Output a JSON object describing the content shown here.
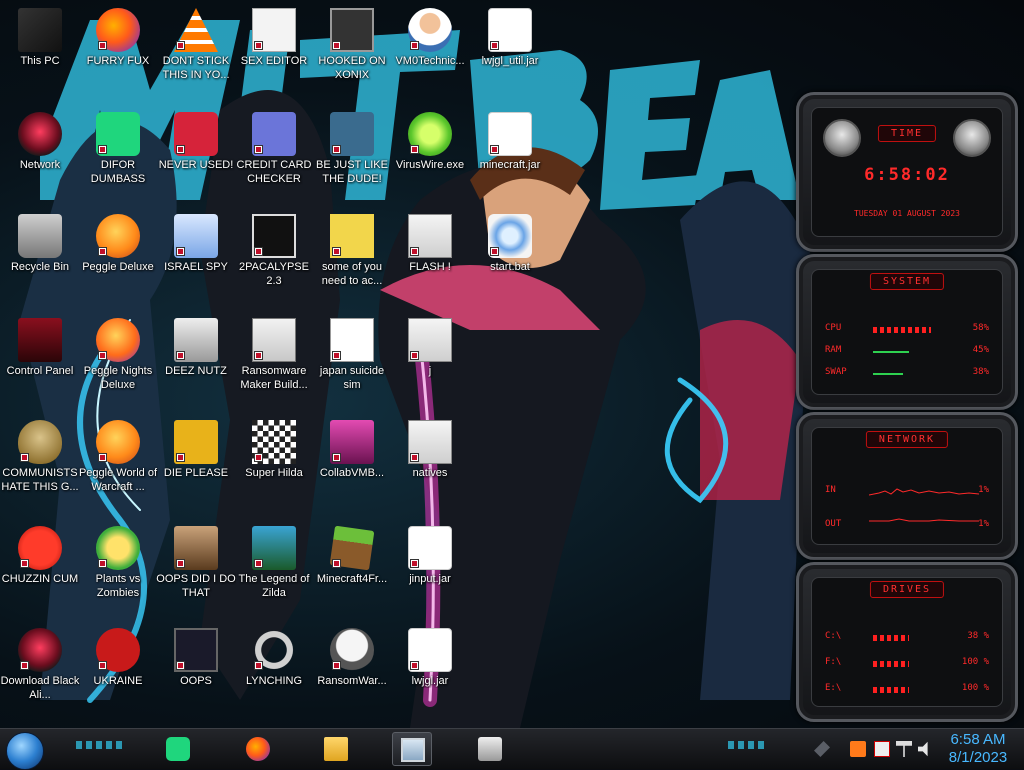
{
  "wallpaper": {
    "description": "",
    "accent": "#2fb6d6",
    "highlight": "#ff3a9a"
  },
  "desktop": {
    "icons": [
      {
        "label": "This PC",
        "icon": "computer-icon"
      },
      {
        "label": "FURRY FUX",
        "icon": "firefox-icon"
      },
      {
        "label": "DONT STICK THIS IN YO...",
        "icon": "vlc-cone-icon"
      },
      {
        "label": "SEX EDITOR",
        "icon": "xd-editor-icon"
      },
      {
        "label": "HOOKED ON XONIX",
        "icon": "xonix-icon"
      },
      {
        "label": "VM0Technic...",
        "icon": "doctor-icon"
      },
      {
        "label": "lwjgl_util.jar",
        "icon": "java-jar-icon"
      },
      {
        "label": "Network",
        "icon": "alien-network-icon"
      },
      {
        "label": "DIFOR DUMBASS",
        "icon": "green-chat-icon"
      },
      {
        "label": "NEVER USED!",
        "icon": "dev-cpp-icon"
      },
      {
        "label": "CREDIT CARD CHECKER",
        "icon": "credit-card-icon"
      },
      {
        "label": "BE JUST LIKE THE DUDE!",
        "icon": "santa-icon"
      },
      {
        "label": "VirusWire.exe",
        "icon": "lime-icon"
      },
      {
        "label": "minecraft.jar",
        "icon": "java-jar-icon"
      },
      {
        "label": "Recycle Bin",
        "icon": "recycle-bin-icon"
      },
      {
        "label": "Peggle Deluxe",
        "icon": "peggle-icon"
      },
      {
        "label": "ISRAEL SPY",
        "icon": "spy-icon"
      },
      {
        "label": "2PACALYPSE 2.3",
        "icon": "terminal-icon"
      },
      {
        "label": "some of you need to ac...",
        "icon": "beaver-icon"
      },
      {
        "label": "FLASH !",
        "icon": "folder-icon"
      },
      {
        "label": "start.bat",
        "icon": "gear-batch-icon"
      },
      {
        "label": "Control Panel",
        "icon": "control-panel-icon"
      },
      {
        "label": "Peggle Nights Deluxe",
        "icon": "peggle-nights-icon"
      },
      {
        "label": "DEEZ NUTZ",
        "icon": "stacked-windows-icon"
      },
      {
        "label": "Ransomware Maker Build...",
        "icon": "app-window-icon"
      },
      {
        "label": "japan suicide sim",
        "icon": "japan-doc-icon"
      },
      {
        "label": "j",
        "icon": "folder-icon"
      },
      {
        "label": "COMMUNISTS HATE THIS G...",
        "icon": "money-bag-icon"
      },
      {
        "label": "Peggle World of Warcraft ...",
        "icon": "peggle-wow-icon"
      },
      {
        "label": "DIE PLEASE",
        "icon": "de-icon"
      },
      {
        "label": "Super Hilda",
        "icon": "pixel-hilda-icon"
      },
      {
        "label": "CollabVMB...",
        "icon": "collabvm-icon"
      },
      {
        "label": "natives",
        "icon": "folder-icon"
      },
      {
        "label": "CHUZZIN CUM",
        "icon": "chuzzle-icon"
      },
      {
        "label": "Plants vs Zombies",
        "icon": "pvz-icon"
      },
      {
        "label": "OOPS DID I DO THAT",
        "icon": "painting-icon"
      },
      {
        "label": "The Legend of Zilda",
        "icon": "zelda-icon"
      },
      {
        "label": "Minecraft4Fr...",
        "icon": "minecraft-block-icon"
      },
      {
        "label": "jinput.jar",
        "icon": "java-jar-icon"
      },
      {
        "label": "Download Black Ali...",
        "icon": "alien-download-icon"
      },
      {
        "label": "UKRAINE",
        "icon": "nuclear-icon"
      },
      {
        "label": "OOPS",
        "icon": "oops-icon"
      },
      {
        "label": "LYNCHING",
        "icon": "rope-icon"
      },
      {
        "label": "RansomWar...",
        "icon": "skull-icon"
      },
      {
        "label": "lwjgl.jar",
        "icon": "java-jar-icon"
      }
    ]
  },
  "widgets": {
    "time": {
      "title": "TIME",
      "clock": "6:58:02",
      "date": "TUESDAY 01 AUGUST 2023"
    },
    "system": {
      "title": "SYSTEM",
      "rows": [
        {
          "label": "CPU",
          "value": "58%",
          "level": 0.58
        },
        {
          "label": "RAM",
          "value": "45%",
          "level": 0.45
        },
        {
          "label": "SWAP",
          "value": "38%",
          "level": 0.38
        }
      ]
    },
    "network": {
      "title": "NETWORK",
      "rows": [
        {
          "label": "IN",
          "value": "1%"
        },
        {
          "label": "OUT",
          "value": "1%"
        }
      ]
    },
    "drives": {
      "title": "DRIVES",
      "rows": [
        {
          "label": "C:\\",
          "value": "38 %"
        },
        {
          "label": "F:\\",
          "value": "100 %"
        },
        {
          "label": "E:\\",
          "value": "100 %"
        }
      ]
    }
  },
  "taskbar": {
    "buttons": [
      {
        "name": "chat-app",
        "icon": "green-chat-icon",
        "active": false
      },
      {
        "name": "firefox",
        "icon": "firefox-icon",
        "active": false
      },
      {
        "name": "file-explorer",
        "icon": "folder-icon",
        "active": false
      },
      {
        "name": "monitor",
        "icon": "monitor-icon",
        "active": true
      },
      {
        "name": "task-view",
        "icon": "stacked-windows-icon",
        "active": false
      }
    ],
    "clock": {
      "time": "6:58 AM",
      "date": "8/1/2023"
    },
    "clock_color": "#48b8ff"
  }
}
